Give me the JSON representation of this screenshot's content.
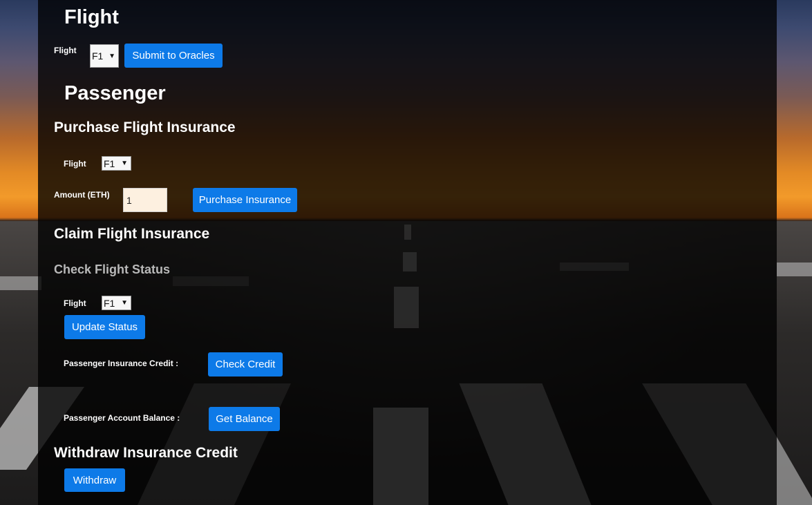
{
  "oracles": {
    "heading": "Flight",
    "flight_label": "Flight",
    "flight_select": "F1",
    "submit_button": "Submit to Oracles"
  },
  "passenger": {
    "heading": "Passenger",
    "purchase": {
      "heading": "Purchase Flight Insurance",
      "flight_label": "Flight",
      "flight_select": "F1",
      "amount_label": "Amount (ETH)",
      "amount_value": "1",
      "purchase_button": "Purchase Insurance"
    },
    "claim": {
      "heading": "Claim Flight Insurance",
      "check_status_heading": "Check Flight Status",
      "flight_label": "Flight",
      "flight_select": "F1",
      "update_button": "Update Status",
      "credit_label": "Passenger Insurance Credit :",
      "check_credit_button": "Check Credit",
      "balance_label": "Passenger Account Balance :",
      "get_balance_button": "Get Balance"
    },
    "withdraw": {
      "heading": "Withdraw Insurance Credit",
      "withdraw_button": "Withdraw"
    }
  },
  "icons": {
    "select_arrow": "chevron-down-icon"
  },
  "colors": {
    "button": "#0d7ae8",
    "panel": "rgba(0,0,0,0.78)",
    "input_bg": "#fdf0e0"
  }
}
